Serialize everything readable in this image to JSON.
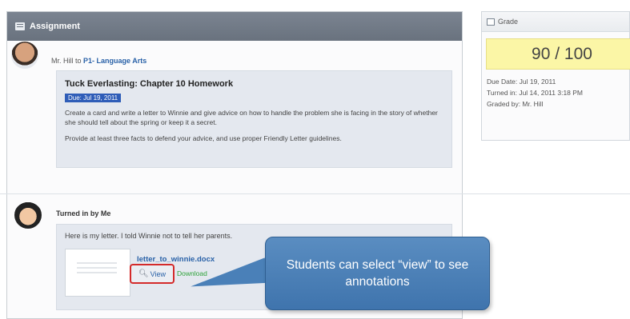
{
  "assignment": {
    "header_title": "Assignment",
    "byline_prefix": "Mr. Hill to",
    "class_name": "P1- Language Arts",
    "title": "Tuck Everlasting: Chapter 10 Homework",
    "due_badge": "Due: Jul 19, 2011",
    "paragraph1": "Create a card and write a letter to Winnie and give advice on how to handle the problem she is facing in the story of whether she should tell about the spring or keep it a secret.",
    "paragraph2": "Provide at least three facts to defend your advice, and use proper Friendly Letter guidelines."
  },
  "submission": {
    "label": "Turned in by Me",
    "note": "Here is my letter. I told Winnie not to tell her parents.",
    "file_name": "letter_to_winnie.docx",
    "view_label": "View",
    "download_label": "Download"
  },
  "callout": {
    "text": "Students can select “view” to see annotations"
  },
  "grade": {
    "header": "Grade",
    "score": "90 / 100",
    "due_date": "Due Date: Jul 19, 2011",
    "turned_in": "Turned in: Jul 14, 2011 3:18 PM",
    "graded_by": "Graded by: Mr. Hill"
  },
  "colors": {
    "header_bg": "#6f7884",
    "due_badge": "#2f5db8",
    "link": "#2a62a8",
    "download": "#2fa23a",
    "view_highlight": "#d42a2a",
    "callout": "#4a80b8",
    "score_bg": "#fbf6a6"
  },
  "icons": {
    "assignment_header": "list-icon",
    "grade_header": "grade-icon",
    "view": "magnifier-icon"
  }
}
